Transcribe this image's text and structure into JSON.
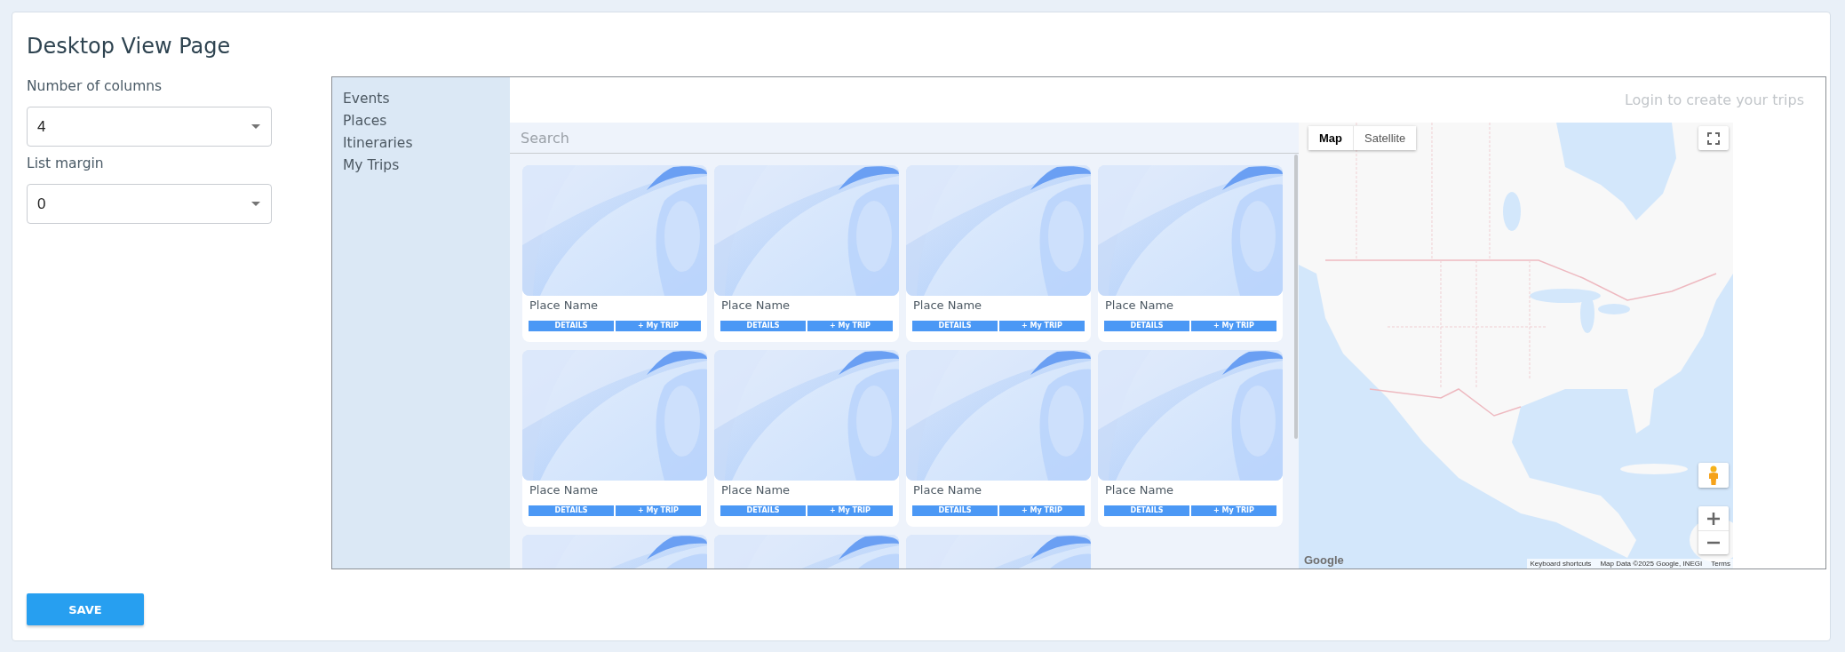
{
  "page": {
    "title": "Desktop View Page"
  },
  "settings": [
    {
      "label": "Number of columns",
      "value": "4"
    },
    {
      "label": "List margin",
      "value": "0"
    }
  ],
  "preview": {
    "nav": [
      "Events",
      "Places",
      "Itineraries",
      "My Trips"
    ],
    "login_link": "Login to create your trips",
    "search": {
      "placeholder": "Search"
    },
    "cards": [
      {
        "kind": "full",
        "name": "Place Name",
        "actions": [
          "DETAILS",
          "+ My TRIP"
        ]
      },
      {
        "kind": "full",
        "name": "Place Name",
        "actions": [
          "DETAILS",
          "+ My TRIP"
        ]
      },
      {
        "kind": "full",
        "name": "Place Name",
        "actions": [
          "DETAILS",
          "+ My TRIP"
        ]
      },
      {
        "kind": "full",
        "name": "Place Name",
        "actions": [
          "DETAILS",
          "+ My TRIP"
        ]
      },
      {
        "kind": "full",
        "name": "Place Name",
        "actions": [
          "DETAILS",
          "+ My TRIP"
        ]
      },
      {
        "kind": "full",
        "name": "Place Name",
        "actions": [
          "DETAILS",
          "+ My TRIP"
        ]
      },
      {
        "kind": "full",
        "name": "Place Name",
        "actions": [
          "DETAILS",
          "+ My TRIP"
        ]
      },
      {
        "kind": "full",
        "name": "Place Name",
        "actions": [
          "DETAILS",
          "+ My TRIP"
        ]
      },
      {
        "kind": "cut"
      },
      {
        "kind": "cut"
      },
      {
        "kind": "cut"
      }
    ],
    "map": {
      "types": [
        {
          "label": "Map",
          "selected": true
        },
        {
          "label": "Satellite",
          "selected": false
        }
      ],
      "logo": "Google",
      "footer": [
        "Keyboard shortcuts",
        "Map Data ©2025 Google, INEGI",
        "Terms"
      ]
    }
  },
  "save_button": "SAVE"
}
